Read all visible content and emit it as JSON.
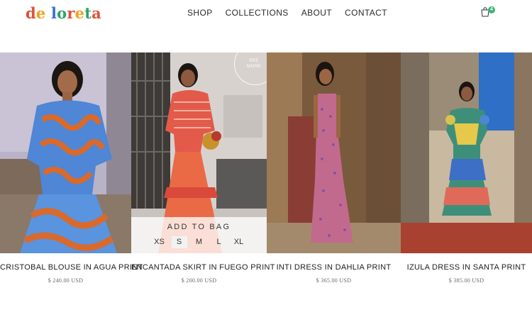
{
  "brand": {
    "letters": [
      {
        "ch": "d",
        "color": "#e0503a"
      },
      {
        "ch": "e",
        "color": "#f0a21f"
      },
      {
        "ch": " ",
        "color": "#ffffff"
      },
      {
        "ch": "l",
        "color": "#3a6fd1"
      },
      {
        "ch": "o",
        "color": "#2ba36a"
      },
      {
        "ch": "r",
        "color": "#e0503a"
      },
      {
        "ch": "e",
        "color": "#f0a21f"
      },
      {
        "ch": "t",
        "color": "#2ba36a"
      },
      {
        "ch": "a",
        "color": "#e0503a"
      }
    ]
  },
  "nav": {
    "items": [
      "SHOP",
      "COLLECTIONS",
      "ABOUT",
      "CONTACT"
    ]
  },
  "cart": {
    "icon": "shopping-bag-icon",
    "count": "4",
    "badge_color": "#3cb371"
  },
  "quick_add": {
    "title": "ADD TO BAG",
    "sizes": [
      "XS",
      "S",
      "M",
      "L",
      "XL"
    ],
    "selected": "S"
  },
  "see_more": {
    "label": "SEE\nMORE"
  },
  "products": [
    {
      "name": "CRISTOBAL BLOUSE IN AGUA PRINT",
      "price": "$ 240.00 USD"
    },
    {
      "name": "ENCANTADA SKIRT IN FUEGO PRINT",
      "price": "$ 200.00 USD"
    },
    {
      "name": "INTI DRESS IN DAHLIA PRINT",
      "price": "$ 365.00 USD"
    },
    {
      "name": "IZULA DRESS IN SANTA PRINT",
      "price": "$ 385.00 USD"
    }
  ]
}
